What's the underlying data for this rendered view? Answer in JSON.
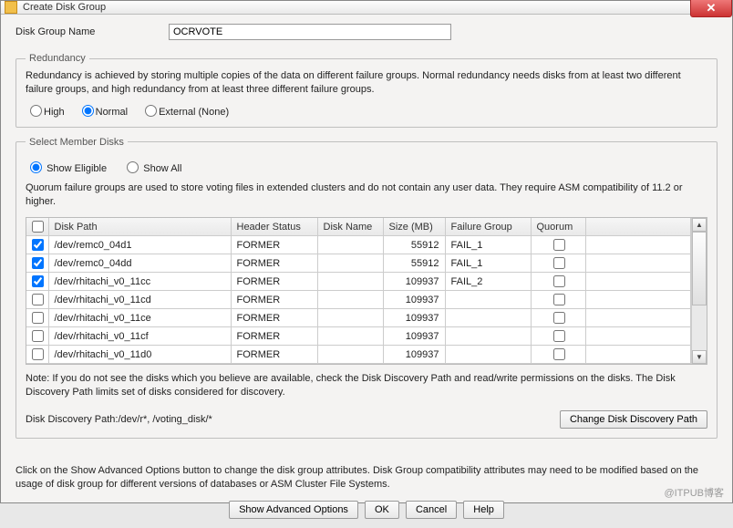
{
  "window": {
    "title": "Create Disk Group",
    "close": "✕"
  },
  "group_name": {
    "label": "Disk Group Name",
    "value": "OCRVOTE"
  },
  "redundancy": {
    "legend": "Redundancy",
    "desc": "Redundancy is achieved by storing multiple copies of the data on different failure groups. Normal redundancy needs disks from at least two different failure groups, and high redundancy from at least three different failure groups.",
    "options": [
      {
        "label": "High",
        "checked": false
      },
      {
        "label": "Normal",
        "checked": true
      },
      {
        "label": "External (None)",
        "checked": false
      }
    ]
  },
  "member": {
    "legend": "Select Member Disks",
    "filter": {
      "eligible": "Show Eligible",
      "all": "Show All",
      "selected": "eligible"
    },
    "quorum_desc": "Quorum failure groups are used to store voting files in extended clusters and do not contain any user data. They require ASM compatibility of 11.2 or higher.",
    "headers": {
      "path": "Disk Path",
      "header_status": "Header Status",
      "disk_name": "Disk Name",
      "size": "Size (MB)",
      "failure_group": "Failure Group",
      "quorum": "Quorum"
    },
    "rows": [
      {
        "checked": true,
        "path": "/dev/remc0_04d1",
        "status": "FORMER",
        "name": "",
        "size": "55912",
        "fg": "FAIL_1",
        "quorum": false
      },
      {
        "checked": true,
        "path": "/dev/remc0_04dd",
        "status": "FORMER",
        "name": "",
        "size": "55912",
        "fg": "FAIL_1",
        "quorum": false
      },
      {
        "checked": true,
        "path": "/dev/rhitachi_v0_11cc",
        "status": "FORMER",
        "name": "",
        "size": "109937",
        "fg": "FAIL_2",
        "quorum": false
      },
      {
        "checked": false,
        "path": "/dev/rhitachi_v0_11cd",
        "status": "FORMER",
        "name": "",
        "size": "109937",
        "fg": "",
        "quorum": false
      },
      {
        "checked": false,
        "path": "/dev/rhitachi_v0_11ce",
        "status": "FORMER",
        "name": "",
        "size": "109937",
        "fg": "",
        "quorum": false
      },
      {
        "checked": false,
        "path": "/dev/rhitachi_v0_11cf",
        "status": "FORMER",
        "name": "",
        "size": "109937",
        "fg": "",
        "quorum": false
      },
      {
        "checked": false,
        "path": "/dev/rhitachi_v0_11d0",
        "status": "FORMER",
        "name": "",
        "size": "109937",
        "fg": "",
        "quorum": false
      }
    ],
    "note": "Note: If you do not see the disks which you believe are available, check the Disk Discovery Path and read/write permissions on the disks. The Disk Discovery Path limits set of disks considered for discovery.",
    "discovery_label": "Disk Discovery Path:/dev/r*, /voting_disk/*",
    "change_path_btn": "Change Disk Discovery Path"
  },
  "footer": {
    "text": "Click on the Show Advanced Options button to change the disk group attributes. Disk Group compatibility attributes may need to be modified based on the usage of disk group for different versions of databases or ASM Cluster File Systems.",
    "buttons": {
      "advanced": "Show Advanced Options",
      "ok": "OK",
      "cancel": "Cancel",
      "help": "Help"
    }
  },
  "watermark": "@ITPUB博客"
}
